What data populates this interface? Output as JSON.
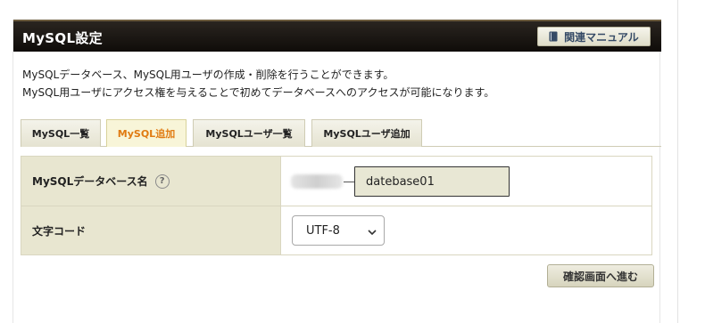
{
  "header": {
    "title": "MySQL設定",
    "manual_label": "関連マニュアル"
  },
  "description": {
    "line1": "MySQLデータベース、MySQL用ユーザの作成・削除を行うことができます。",
    "line2": "MySQL用ユーザにアクセス権を与えることで初めてデータベースへのアクセスが可能になります。"
  },
  "tabs": [
    {
      "label": "MySQL一覧",
      "active": false
    },
    {
      "label": "MySQL追加",
      "active": true
    },
    {
      "label": "MySQLユーザ一覧",
      "active": false
    },
    {
      "label": "MySQLユーザ追加",
      "active": false
    }
  ],
  "form": {
    "db_name_label": "MySQLデータベース名",
    "help_icon": "question-mark-icon",
    "db_name_value": "datebase01",
    "charset_label": "文字コード",
    "charset_value": "UTF-8"
  },
  "submit_label": "確認画面へ進む",
  "colors": {
    "header_bg": "#0f0c09",
    "active_tab_text": "#e07b12",
    "label_bg": "#e8e6d0",
    "manual_text": "#354a66"
  }
}
